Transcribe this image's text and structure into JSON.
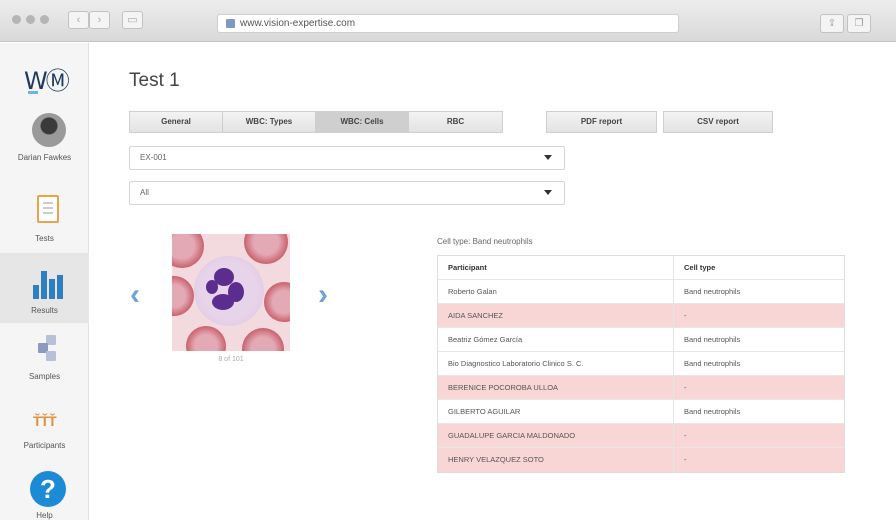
{
  "browser": {
    "url": "www.vision-expertise.com"
  },
  "sidebar": {
    "user_name": "Darian Fawkes",
    "items": [
      {
        "label": "Tests",
        "icon": "tests-icon"
      },
      {
        "label": "Results",
        "icon": "bar-chart-icon",
        "active": true
      },
      {
        "label": "Samples",
        "icon": "samples-icon"
      },
      {
        "label": "Participants",
        "icon": "participants-icon"
      },
      {
        "label": "Help",
        "icon": "help-icon"
      }
    ]
  },
  "page": {
    "title": "Test 1"
  },
  "tabs": [
    {
      "label": "General"
    },
    {
      "label": "WBC: Types"
    },
    {
      "label": "WBC: Cells",
      "active": true
    },
    {
      "label": "RBC"
    }
  ],
  "reports": [
    {
      "label": "PDF report"
    },
    {
      "label": "CSV report"
    }
  ],
  "selects": {
    "sample": "EX-001",
    "filter": "All"
  },
  "viewer": {
    "caption": "8 of 101"
  },
  "results": {
    "cell_type_label": "Cell type: Band neutrophils",
    "headers": [
      "Participant",
      "Cell type"
    ],
    "rows": [
      {
        "participant": "Roberto Galan",
        "cell_type": "Band neutrophils",
        "mismatch": false
      },
      {
        "participant": "AIDA SANCHEZ",
        "cell_type": "-",
        "mismatch": true
      },
      {
        "participant": "Beatriz Gómez García",
        "cell_type": "Band neutrophils",
        "mismatch": false
      },
      {
        "participant": "Bio Diagnostico Laboratorio Clinico S. C.",
        "cell_type": "Band neutrophils",
        "mismatch": false
      },
      {
        "participant": "BERENICE POCOROBA ULLOA",
        "cell_type": "-",
        "mismatch": true
      },
      {
        "participant": "GILBERTO AGUILAR",
        "cell_type": "Band neutrophils",
        "mismatch": false
      },
      {
        "participant": "GUADALUPE GARCIA MALDONADO",
        "cell_type": "-",
        "mismatch": true
      },
      {
        "participant": "HENRY VELAZQUEZ SOTO",
        "cell_type": "-",
        "mismatch": true
      }
    ]
  }
}
